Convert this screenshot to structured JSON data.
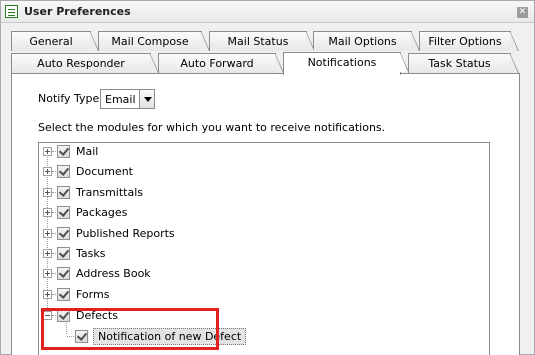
{
  "window": {
    "title": "User Preferences",
    "close_icon": "close-icon"
  },
  "tabs_row1": [
    {
      "label": "General"
    },
    {
      "label": "Mail Compose"
    },
    {
      "label": "Mail Status"
    },
    {
      "label": "Mail Options"
    },
    {
      "label": "Filter Options"
    }
  ],
  "tabs_row2": [
    {
      "label": "Auto Responder"
    },
    {
      "label": "Auto Forward"
    },
    {
      "label": "Notifications",
      "active": true
    },
    {
      "label": "Task Status"
    }
  ],
  "notify": {
    "label": "Notify Type:",
    "selected": "Email"
  },
  "instructions": "Select the modules for which you want to receive notifications.",
  "modules": [
    {
      "label": "Mail",
      "checked": true
    },
    {
      "label": "Document",
      "checked": true
    },
    {
      "label": "Transmittals",
      "checked": true
    },
    {
      "label": "Packages",
      "checked": true
    },
    {
      "label": "Published Reports",
      "checked": true
    },
    {
      "label": "Tasks",
      "checked": true
    },
    {
      "label": "Address Book",
      "checked": true
    },
    {
      "label": "Forms",
      "checked": true
    },
    {
      "label": "Defects",
      "checked": true,
      "expanded": true
    }
  ],
  "defects_children": [
    {
      "label": "Notification of new Defect",
      "checked": true
    }
  ],
  "colors": {
    "highlight": "#e32020",
    "window_bg": "#f0f0f0"
  }
}
